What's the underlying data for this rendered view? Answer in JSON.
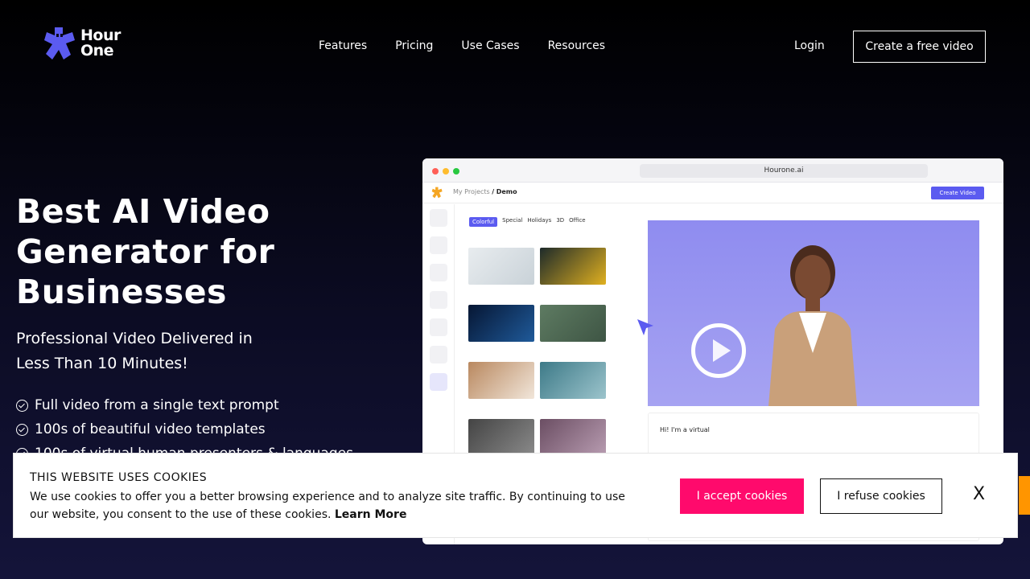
{
  "logo": {
    "line1": "Hour",
    "line2": "One",
    "brand_color": "#5b5bf0"
  },
  "nav": {
    "items": [
      "Features",
      "Pricing",
      "Use Cases",
      "Resources"
    ]
  },
  "header": {
    "login": "Login",
    "cta": "Create a free video"
  },
  "hero": {
    "title_lines": [
      "Best AI Video",
      "Generator for",
      "Businesses"
    ],
    "subtitle_lines": [
      "Professional Video Delivered in",
      "Less Than 10 Minutes!"
    ],
    "bullets": [
      "Full video from a single text prompt",
      "100s of beautiful video templates",
      "100s of virtual human presenters & languages"
    ]
  },
  "mockup": {
    "url": "Hourone.ai",
    "breadcrumb_parent": "My Projects",
    "breadcrumb_sep": "/",
    "breadcrumb_current": "Demo",
    "create_button": "Create Video",
    "tabs": [
      "Colorful",
      "Special",
      "Holidays",
      "3D",
      "Office"
    ],
    "script_text": "Hi! I'm a virtual"
  },
  "cookie": {
    "title": "THIS WEBSITE USES COOKIES",
    "text": "We use cookies to offer you a better browsing experience and to analyze site traffic. By continuing to use our website, you consent to the use of these cookies.",
    "learn_more": "Learn More",
    "accept": "I accept cookies",
    "refuse": "I refuse cookies",
    "close": "X",
    "accept_color": "#ff0a6c"
  }
}
